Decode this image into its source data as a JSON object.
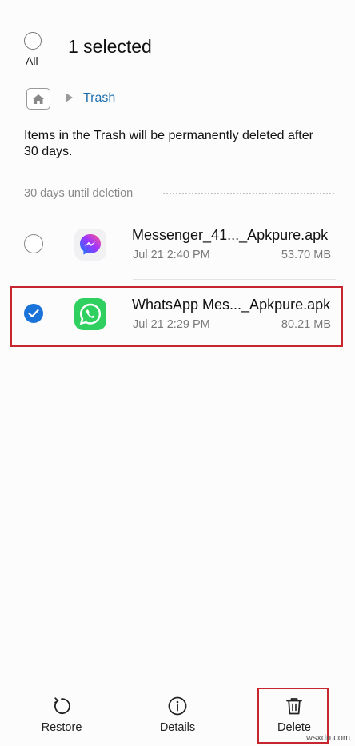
{
  "header": {
    "select_all_label": "All",
    "title": "1 selected"
  },
  "breadcrumb": {
    "home_icon": "home-icon",
    "current": "Trash"
  },
  "info_text": "Items in the Trash will be permanently deleted after 30 days.",
  "section": {
    "label": "30 days until deletion"
  },
  "files": [
    {
      "name": "Messenger_41..._Apkpure.apk",
      "date": "Jul 21 2:40 PM",
      "size": "53.70 MB",
      "selected": false,
      "icon": "messenger-icon"
    },
    {
      "name": "WhatsApp Mes..._Apkpure.apk",
      "date": "Jul 21 2:29 PM",
      "size": "80.21 MB",
      "selected": true,
      "icon": "whatsapp-icon"
    }
  ],
  "bottom_bar": {
    "restore_label": "Restore",
    "details_label": "Details",
    "delete_label": "Delete"
  },
  "colors": {
    "accent": "#1a73d9",
    "link": "#1f6fae",
    "highlight": "#c7262f",
    "whatsapp": "#25d366"
  },
  "watermark": "wsxdn.com"
}
